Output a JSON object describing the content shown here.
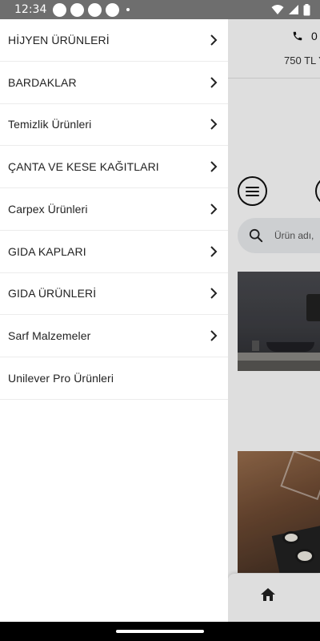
{
  "status_bar": {
    "time": "12:34"
  },
  "drawer": {
    "items": [
      {
        "label": "HİJYEN ÜRÜNLERİ",
        "has_chevron": true
      },
      {
        "label": "BARDAKLAR",
        "has_chevron": true
      },
      {
        "label": "Temizlik Ürünleri",
        "has_chevron": true
      },
      {
        "label": "ÇANTA VE KESE KAĞITLARI",
        "has_chevron": true
      },
      {
        "label": "Carpex Ürünleri",
        "has_chevron": true
      },
      {
        "label": "GIDA KAPLARI",
        "has_chevron": true
      },
      {
        "label": "GIDA ÜRÜNLERİ",
        "has_chevron": true
      },
      {
        "label": "Sarf Malzemeler",
        "has_chevron": true
      },
      {
        "label": "Unilever Pro Ürünleri",
        "has_chevron": false
      }
    ]
  },
  "background": {
    "phone_text": "0",
    "shipping_text": "750 TL Y",
    "search_placeholder": "Ürün adı,"
  },
  "icons": {
    "phone": "phone-icon",
    "menu": "hamburger-menu-icon",
    "search": "search-icon",
    "chevron": "chevron-right-icon",
    "home": "home-icon"
  },
  "colors": {
    "status_bar": "#6e6e6e",
    "drawer_bg": "#ffffff",
    "divider": "#ececec",
    "search_bg": "#eceef1",
    "text": "#222222"
  }
}
